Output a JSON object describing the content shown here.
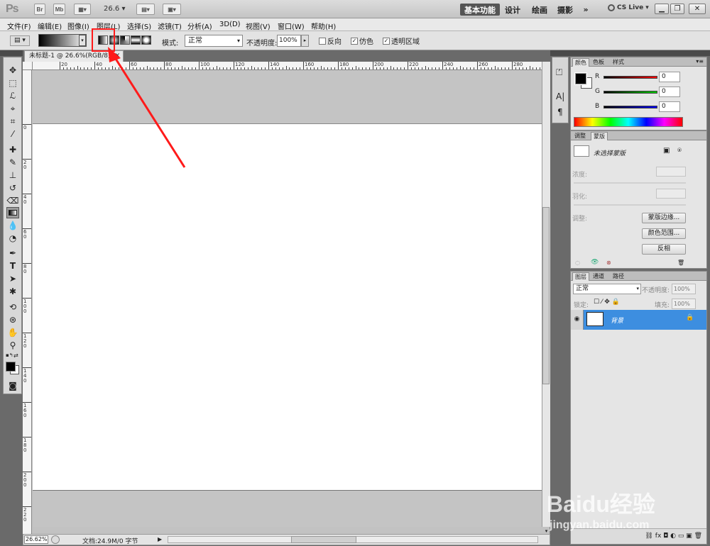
{
  "app": {
    "logo": "Ps",
    "zoom": "26.6",
    "bridge_btn": "Br",
    "minibridge_btn": "Mb",
    "cslive": "CS Live"
  },
  "workspaces": [
    "基本功能",
    "设计",
    "绘画",
    "摄影",
    "»"
  ],
  "menu": [
    "文件(F)",
    "编辑(E)",
    "图像(I)",
    "图层(L)",
    "选择(S)",
    "滤镜(T)",
    "分析(A)",
    "3D(D)",
    "视图(V)",
    "窗口(W)",
    "帮助(H)"
  ],
  "options": {
    "mode_label": "模式:",
    "mode_value": "正常",
    "opacity_label": "不透明度:",
    "opacity_value": "100%",
    "reverse": "反向",
    "dither": "仿色",
    "transparency": "透明区域",
    "dither_checked": true,
    "transparency_checked": true,
    "reverse_checked": false,
    "gradient_types": [
      "linear",
      "radial",
      "angle",
      "reflected",
      "diamond"
    ],
    "selected_gradient_type": "linear"
  },
  "document": {
    "tab_title": "未标题-1 @ 26.6%(RGB/8)",
    "ruler_h": [
      "20",
      "40",
      "60",
      "80",
      "100",
      "120",
      "140",
      "160",
      "180",
      "200",
      "220",
      "240",
      "260",
      "280"
    ],
    "ruler_v": [
      "0",
      "2 0",
      "4 0",
      "6 0",
      "8 0",
      "1 0 0",
      "1 2 0",
      "1 4 0",
      "1 6 0",
      "1 8 0",
      "2 0 0",
      "2 2 0"
    ],
    "status_zoom": "26.62%",
    "status_info": "文档:24.9M/0 字节"
  },
  "color_panel": {
    "tabs": [
      "颜色",
      "色板",
      "样式"
    ],
    "channels": [
      {
        "label": "R",
        "value": "0",
        "color": "#cc0000"
      },
      {
        "label": "G",
        "value": "0",
        "color": "#00aa00"
      },
      {
        "label": "B",
        "value": "0",
        "color": "#0000cc"
      }
    ],
    "foreground": "#000000",
    "background": "#ffffff"
  },
  "masks_panel": {
    "tabs": [
      "调整",
      "蒙版"
    ],
    "title": "未选择蒙版",
    "density": "浓度:",
    "feather": "羽化:",
    "refine": "调整:",
    "btn_edge": "蒙版边缘...",
    "btn_color_range": "颜色范围...",
    "btn_invert": "反相"
  },
  "layers_panel": {
    "tabs": [
      "图层",
      "通道",
      "路径"
    ],
    "blend_mode": "正常",
    "opacity_label": "不透明度:",
    "opacity_value": "100%",
    "lock_label": "锁定:",
    "fill_label": "填充:",
    "fill_value": "100%",
    "layer_name": "背景"
  },
  "annotation": {
    "color": "#ff0000"
  },
  "watermark": {
    "brand": "Baidu经验",
    "url": "jingyan.baidu.com"
  }
}
